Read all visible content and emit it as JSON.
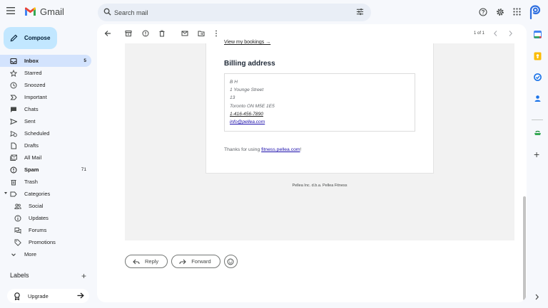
{
  "app": {
    "name": "Gmail",
    "search_placeholder": "Search mail"
  },
  "compose": {
    "label": "Compose"
  },
  "nav": [
    {
      "label": "Inbox",
      "count": "5",
      "icon": "inbox-icon",
      "active": true,
      "bold": true
    },
    {
      "label": "Starred",
      "icon": "star-icon"
    },
    {
      "label": "Snoozed",
      "icon": "clock-icon"
    },
    {
      "label": "Important",
      "icon": "important-icon"
    },
    {
      "label": "Chats",
      "icon": "chat-icon"
    },
    {
      "label": "Sent",
      "icon": "send-icon"
    },
    {
      "label": "Scheduled",
      "icon": "scheduled-send-icon"
    },
    {
      "label": "Drafts",
      "icon": "draft-icon"
    },
    {
      "label": "All Mail",
      "icon": "all-mail-icon"
    },
    {
      "label": "Spam",
      "count": "71",
      "icon": "spam-icon",
      "bold": true
    },
    {
      "label": "Trash",
      "icon": "trash-icon"
    },
    {
      "label": "Categories",
      "icon": "label-icon"
    },
    {
      "label": "Social",
      "icon": "people-icon",
      "sub": true
    },
    {
      "label": "Updates",
      "icon": "info-icon",
      "sub": true
    },
    {
      "label": "Forums",
      "icon": "forum-icon",
      "sub": true
    },
    {
      "label": "Promotions",
      "icon": "tag-icon",
      "sub": true
    },
    {
      "label": "More",
      "icon": "chevron-down-icon"
    }
  ],
  "labels": {
    "title": "Labels"
  },
  "upgrade": {
    "label": "Upgrade"
  },
  "toolbar": {
    "pager": "1 of 1"
  },
  "email": {
    "view_bookings": "View my bookings →",
    "billing_title": "Billing address",
    "address_lines": [
      "B H",
      "1 Younge Street",
      "13",
      "Toronto ON M5E 1E5"
    ],
    "phone": "1-416-456-7890",
    "email": "info@pellea.com",
    "thanks_prefix": "Thanks for using ",
    "thanks_link": "fitness.pellea.com",
    "thanks_suffix": "!",
    "footer": "Pellea Inc. d.b.a. Pellea Fitness"
  },
  "actions": {
    "reply": "Reply",
    "forward": "Forward"
  },
  "colors": {
    "accent": "#0b57d0",
    "compose_bg": "#c2e7ff",
    "active_nav": "#d3e3fd",
    "link": "#1a0dab"
  }
}
